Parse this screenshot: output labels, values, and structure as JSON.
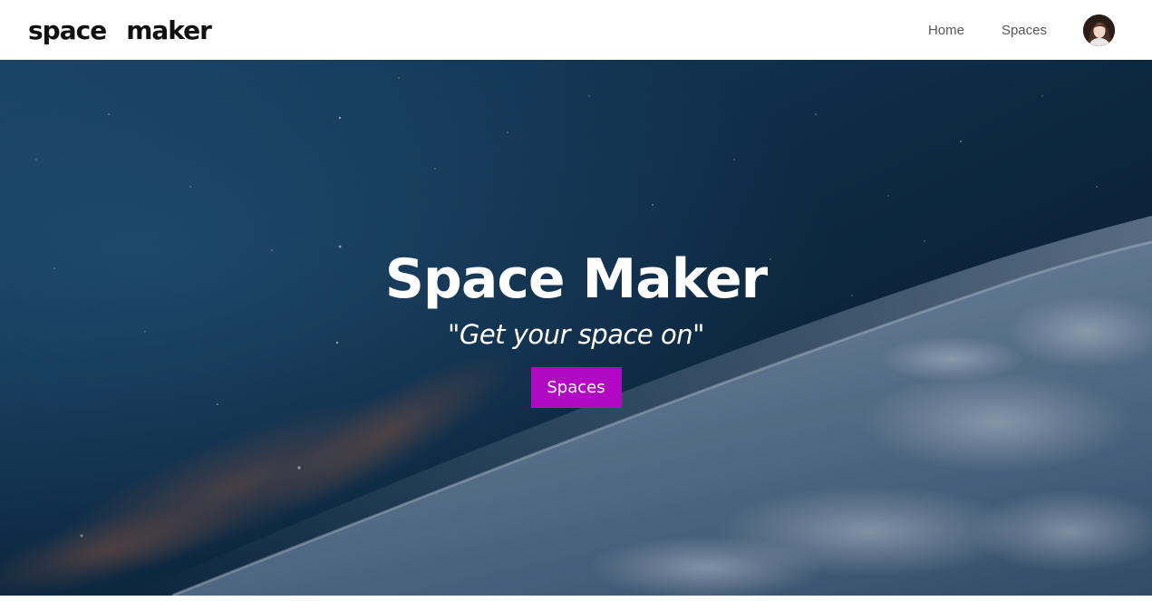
{
  "header": {
    "brand_word1": "space",
    "brand_word2": "maker",
    "nav": [
      {
        "label": "Home"
      },
      {
        "label": "Spaces"
      }
    ]
  },
  "hero": {
    "title": "Space Maker",
    "tagline": "\"Get your space on\"",
    "button_label": "Spaces"
  },
  "colors": {
    "accent": "#b108c4",
    "header_bg": "#ffffff",
    "nav_text": "#555555",
    "hero_text": "#ffffff"
  },
  "icons": {
    "avatar": "user-avatar"
  }
}
